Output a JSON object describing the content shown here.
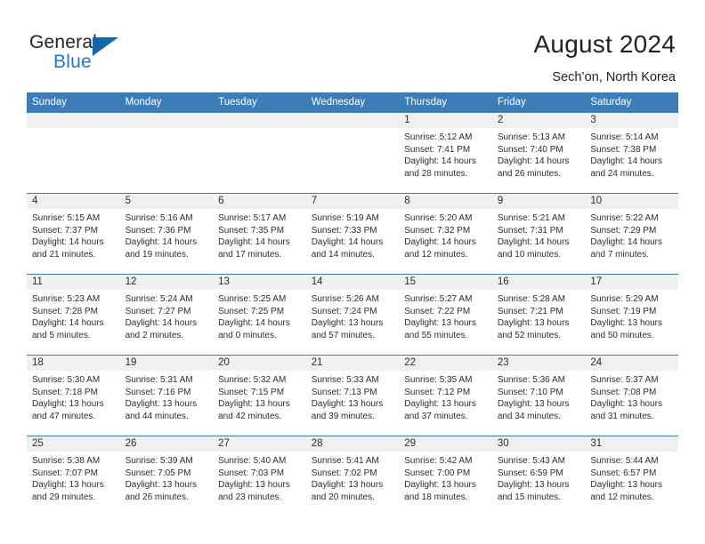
{
  "brand": {
    "name_part1": "General",
    "name_part2": "Blue",
    "accent_color": "#2277cc",
    "triangle_color": "#1565a8"
  },
  "header": {
    "title": "August 2024",
    "subtitle": "Sech’on, North Korea"
  },
  "theme": {
    "header_row_bg": "#3b7cb9",
    "daynum_bg": "#f0f0f0",
    "row_divider": "#3b7cb9"
  },
  "weekday_headers": [
    "Sunday",
    "Monday",
    "Tuesday",
    "Wednesday",
    "Thursday",
    "Friday",
    "Saturday"
  ],
  "weeks": [
    [
      {
        "day": "",
        "lines": []
      },
      {
        "day": "",
        "lines": []
      },
      {
        "day": "",
        "lines": []
      },
      {
        "day": "",
        "lines": []
      },
      {
        "day": "1",
        "lines": [
          "Sunrise: 5:12 AM",
          "Sunset: 7:41 PM",
          "Daylight: 14 hours",
          "and 28 minutes."
        ]
      },
      {
        "day": "2",
        "lines": [
          "Sunrise: 5:13 AM",
          "Sunset: 7:40 PM",
          "Daylight: 14 hours",
          "and 26 minutes."
        ]
      },
      {
        "day": "3",
        "lines": [
          "Sunrise: 5:14 AM",
          "Sunset: 7:38 PM",
          "Daylight: 14 hours",
          "and 24 minutes."
        ]
      }
    ],
    [
      {
        "day": "4",
        "lines": [
          "Sunrise: 5:15 AM",
          "Sunset: 7:37 PM",
          "Daylight: 14 hours",
          "and 21 minutes."
        ]
      },
      {
        "day": "5",
        "lines": [
          "Sunrise: 5:16 AM",
          "Sunset: 7:36 PM",
          "Daylight: 14 hours",
          "and 19 minutes."
        ]
      },
      {
        "day": "6",
        "lines": [
          "Sunrise: 5:17 AM",
          "Sunset: 7:35 PM",
          "Daylight: 14 hours",
          "and 17 minutes."
        ]
      },
      {
        "day": "7",
        "lines": [
          "Sunrise: 5:19 AM",
          "Sunset: 7:33 PM",
          "Daylight: 14 hours",
          "and 14 minutes."
        ]
      },
      {
        "day": "8",
        "lines": [
          "Sunrise: 5:20 AM",
          "Sunset: 7:32 PM",
          "Daylight: 14 hours",
          "and 12 minutes."
        ]
      },
      {
        "day": "9",
        "lines": [
          "Sunrise: 5:21 AM",
          "Sunset: 7:31 PM",
          "Daylight: 14 hours",
          "and 10 minutes."
        ]
      },
      {
        "day": "10",
        "lines": [
          "Sunrise: 5:22 AM",
          "Sunset: 7:29 PM",
          "Daylight: 14 hours",
          "and 7 minutes."
        ]
      }
    ],
    [
      {
        "day": "11",
        "lines": [
          "Sunrise: 5:23 AM",
          "Sunset: 7:28 PM",
          "Daylight: 14 hours",
          "and 5 minutes."
        ]
      },
      {
        "day": "12",
        "lines": [
          "Sunrise: 5:24 AM",
          "Sunset: 7:27 PM",
          "Daylight: 14 hours",
          "and 2 minutes."
        ]
      },
      {
        "day": "13",
        "lines": [
          "Sunrise: 5:25 AM",
          "Sunset: 7:25 PM",
          "Daylight: 14 hours",
          "and 0 minutes."
        ]
      },
      {
        "day": "14",
        "lines": [
          "Sunrise: 5:26 AM",
          "Sunset: 7:24 PM",
          "Daylight: 13 hours",
          "and 57 minutes."
        ]
      },
      {
        "day": "15",
        "lines": [
          "Sunrise: 5:27 AM",
          "Sunset: 7:22 PM",
          "Daylight: 13 hours",
          "and 55 minutes."
        ]
      },
      {
        "day": "16",
        "lines": [
          "Sunrise: 5:28 AM",
          "Sunset: 7:21 PM",
          "Daylight: 13 hours",
          "and 52 minutes."
        ]
      },
      {
        "day": "17",
        "lines": [
          "Sunrise: 5:29 AM",
          "Sunset: 7:19 PM",
          "Daylight: 13 hours",
          "and 50 minutes."
        ]
      }
    ],
    [
      {
        "day": "18",
        "lines": [
          "Sunrise: 5:30 AM",
          "Sunset: 7:18 PM",
          "Daylight: 13 hours",
          "and 47 minutes."
        ]
      },
      {
        "day": "19",
        "lines": [
          "Sunrise: 5:31 AM",
          "Sunset: 7:16 PM",
          "Daylight: 13 hours",
          "and 44 minutes."
        ]
      },
      {
        "day": "20",
        "lines": [
          "Sunrise: 5:32 AM",
          "Sunset: 7:15 PM",
          "Daylight: 13 hours",
          "and 42 minutes."
        ]
      },
      {
        "day": "21",
        "lines": [
          "Sunrise: 5:33 AM",
          "Sunset: 7:13 PM",
          "Daylight: 13 hours",
          "and 39 minutes."
        ]
      },
      {
        "day": "22",
        "lines": [
          "Sunrise: 5:35 AM",
          "Sunset: 7:12 PM",
          "Daylight: 13 hours",
          "and 37 minutes."
        ]
      },
      {
        "day": "23",
        "lines": [
          "Sunrise: 5:36 AM",
          "Sunset: 7:10 PM",
          "Daylight: 13 hours",
          "and 34 minutes."
        ]
      },
      {
        "day": "24",
        "lines": [
          "Sunrise: 5:37 AM",
          "Sunset: 7:08 PM",
          "Daylight: 13 hours",
          "and 31 minutes."
        ]
      }
    ],
    [
      {
        "day": "25",
        "lines": [
          "Sunrise: 5:38 AM",
          "Sunset: 7:07 PM",
          "Daylight: 13 hours",
          "and 29 minutes."
        ]
      },
      {
        "day": "26",
        "lines": [
          "Sunrise: 5:39 AM",
          "Sunset: 7:05 PM",
          "Daylight: 13 hours",
          "and 26 minutes."
        ]
      },
      {
        "day": "27",
        "lines": [
          "Sunrise: 5:40 AM",
          "Sunset: 7:03 PM",
          "Daylight: 13 hours",
          "and 23 minutes."
        ]
      },
      {
        "day": "28",
        "lines": [
          "Sunrise: 5:41 AM",
          "Sunset: 7:02 PM",
          "Daylight: 13 hours",
          "and 20 minutes."
        ]
      },
      {
        "day": "29",
        "lines": [
          "Sunrise: 5:42 AM",
          "Sunset: 7:00 PM",
          "Daylight: 13 hours",
          "and 18 minutes."
        ]
      },
      {
        "day": "30",
        "lines": [
          "Sunrise: 5:43 AM",
          "Sunset: 6:59 PM",
          "Daylight: 13 hours",
          "and 15 minutes."
        ]
      },
      {
        "day": "31",
        "lines": [
          "Sunrise: 5:44 AM",
          "Sunset: 6:57 PM",
          "Daylight: 13 hours",
          "and 12 minutes."
        ]
      }
    ]
  ]
}
